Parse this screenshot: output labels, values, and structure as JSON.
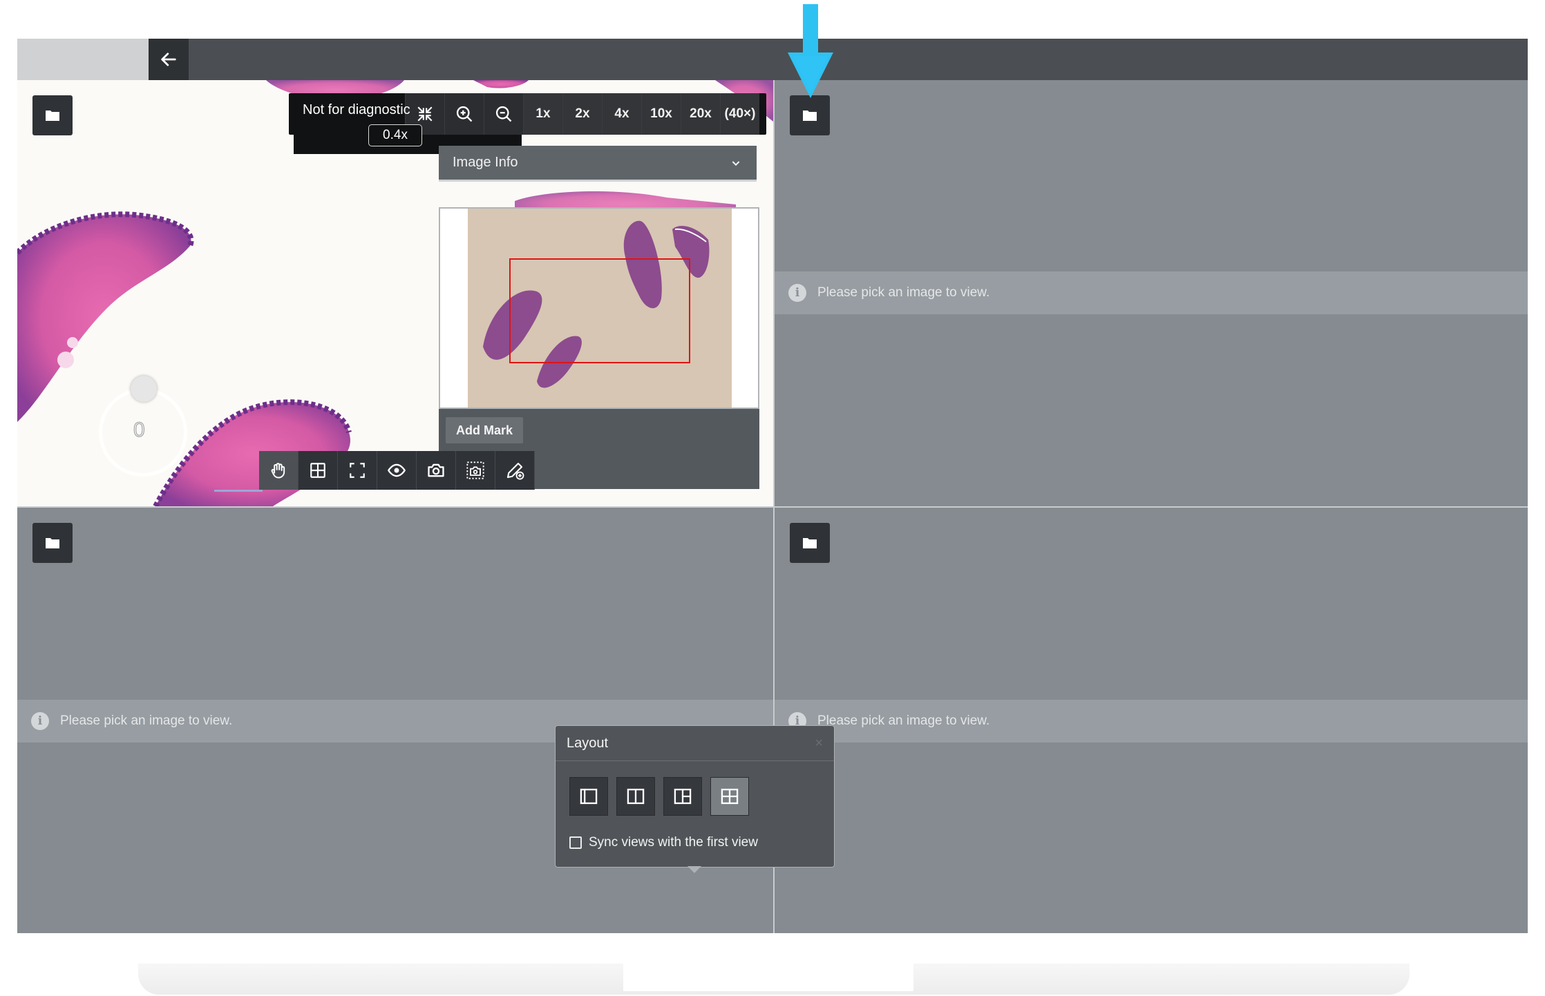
{
  "toolbar": {
    "diagnostic_notice": "Not for diagnostic",
    "scale": "0.4x",
    "zoom_levels": [
      "1x",
      "2x",
      "4x",
      "10x",
      "20x",
      "(40×)"
    ]
  },
  "image_info": {
    "label": "Image Info"
  },
  "minimap": {
    "add_mark_label": "Add Mark"
  },
  "rotation": {
    "value": "0"
  },
  "panes": {
    "empty_message": "Please pick an image to view."
  },
  "layout_popup": {
    "title": "Layout",
    "close": "×",
    "sync_label": "Sync views with the first view",
    "options": [
      "single",
      "two-column",
      "three-panel",
      "four-grid"
    ],
    "selected": "four-grid"
  },
  "colors": {
    "topbar": "#4b4f53",
    "pane_bg": "#858b91",
    "toolbar_bg": "#2f3236",
    "annotation_arrow": "#2ec2f3",
    "viewport_rect": "#e01414"
  }
}
